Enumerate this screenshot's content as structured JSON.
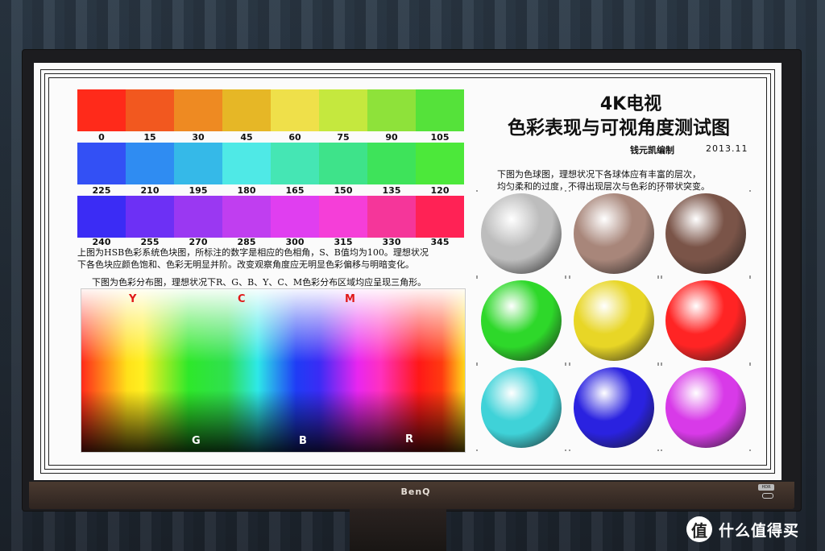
{
  "monitor": {
    "brand": "BenQ",
    "hdr_badge": "HDR"
  },
  "hue_rows": [
    {
      "labels": [
        "0",
        "15",
        "30",
        "45",
        "60",
        "75",
        "90",
        "105"
      ],
      "colors": [
        "#ff2a1a",
        "#f2581f",
        "#ee8a22",
        "#e6b726",
        "#efe04a",
        "#c5e83e",
        "#8ee23a",
        "#55e23a"
      ]
    },
    {
      "labels": [
        "225",
        "210",
        "195",
        "180",
        "165",
        "150",
        "135",
        "120"
      ],
      "colors": [
        "#3350f5",
        "#2f8cf2",
        "#35b9e8",
        "#4fe9e6",
        "#45e6b4",
        "#3ee38a",
        "#3ee35a",
        "#4ce83a"
      ]
    },
    {
      "labels": [
        "240",
        "255",
        "270",
        "285",
        "300",
        "315",
        "330",
        "345"
      ],
      "colors": [
        "#3b2cf5",
        "#6d30f5",
        "#9a38f2",
        "#c03ef0",
        "#e03ef0",
        "#f53ed8",
        "#f5369a",
        "#ff2255"
      ]
    }
  ],
  "hsb_note_line1": "上图为HSB色彩系统色块图，所标注的数字是相应的色相角，S、B值均为100。理想状况",
  "hsb_note_line2": "下各色块应颜色饱和、色彩无明显并阶。改变观察角度应无明显色彩偏移与明暗变化。",
  "chart_note": "下图为色彩分布图，理想状况下R、G、B、Y、C、M色彩分布区域均应呈现三角形。",
  "chart_letters": {
    "y": "Y",
    "c": "C",
    "m": "M",
    "g": "G",
    "b": "B",
    "r": "R"
  },
  "title_line1": "4K电视",
  "title_line2": "色彩表现与可视角度测试图",
  "author": "钱元凯编制",
  "date": "2013.11",
  "sphere_note_line1": "下图为色球图，理想状况下各球体应有丰富的层次，",
  "sphere_note_line2": "均匀柔和的过度，不得出现层次与色彩的环带状突变。",
  "spheres": [
    {
      "name": "sphere-gray",
      "color": "#bdbdbd"
    },
    {
      "name": "sphere-brown-light",
      "color": "#a8867a"
    },
    {
      "name": "sphere-brown-dark",
      "color": "#7a5448"
    },
    {
      "name": "sphere-green",
      "color": "#2ed82a"
    },
    {
      "name": "sphere-yellow",
      "color": "#e8d626"
    },
    {
      "name": "sphere-red",
      "color": "#ff2424"
    },
    {
      "name": "sphere-cyan",
      "color": "#3fd2d8"
    },
    {
      "name": "sphere-blue",
      "color": "#2a22e0"
    },
    {
      "name": "sphere-magenta",
      "color": "#d83ae8"
    }
  ],
  "watermark": {
    "icon": "值",
    "text": "什么值得买"
  }
}
